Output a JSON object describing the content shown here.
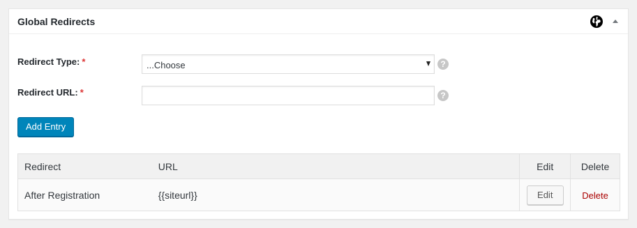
{
  "panel": {
    "title": "Global Redirects",
    "globe_icon": "globe-icon",
    "toggle_icon": "collapse-arrow-icon"
  },
  "form": {
    "redirect_type": {
      "label": "Redirect Type:",
      "required_mark": "*",
      "selected_value": "...Choose"
    },
    "redirect_url": {
      "label": "Redirect URL:",
      "required_mark": "*",
      "value": ""
    },
    "help_glyph": "?",
    "add_button_label": "Add Entry"
  },
  "table": {
    "headers": {
      "redirect": "Redirect",
      "url": "URL",
      "edit": "Edit",
      "delete": "Delete"
    },
    "rows": [
      {
        "redirect": "After Registration",
        "url": "{{siteurl}}",
        "edit_label": "Edit",
        "delete_label": "Delete"
      }
    ]
  },
  "colors": {
    "primary_button": "#0085ba",
    "required": "#dc3232",
    "delete_link": "#aa0000"
  }
}
